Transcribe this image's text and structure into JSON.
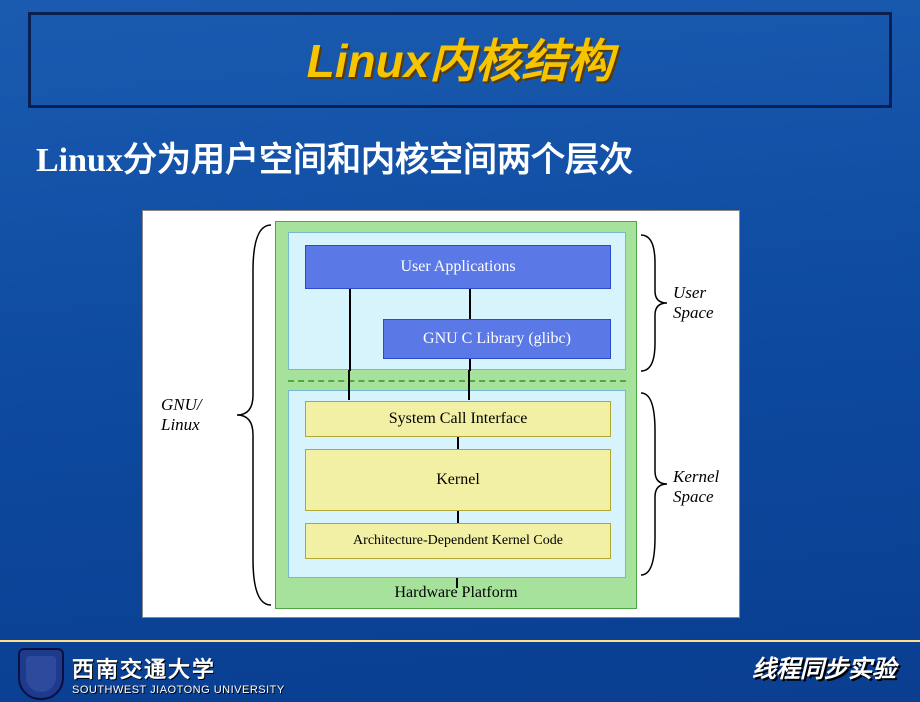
{
  "title": "Linux内核结构",
  "subtitle": "Linux分为用户空间和内核空间两个层次",
  "diagram": {
    "user_apps": "User Applications",
    "glibc": "GNU C Library (glibc)",
    "sci": "System Call Interface",
    "kernel": "Kernel",
    "arch_code": "Architecture-Dependent Kernel Code",
    "hardware": "Hardware Platform",
    "left_label_1": "GNU/",
    "left_label_2": "Linux",
    "right_user_1": "User",
    "right_user_2": "Space",
    "right_kernel_1": "Kernel",
    "right_kernel_2": "Space"
  },
  "footer": {
    "university_cn": "西南交通大学",
    "university_en": "SOUTHWEST JIAOTONG UNIVERSITY",
    "right_text": "线程同步实验"
  }
}
